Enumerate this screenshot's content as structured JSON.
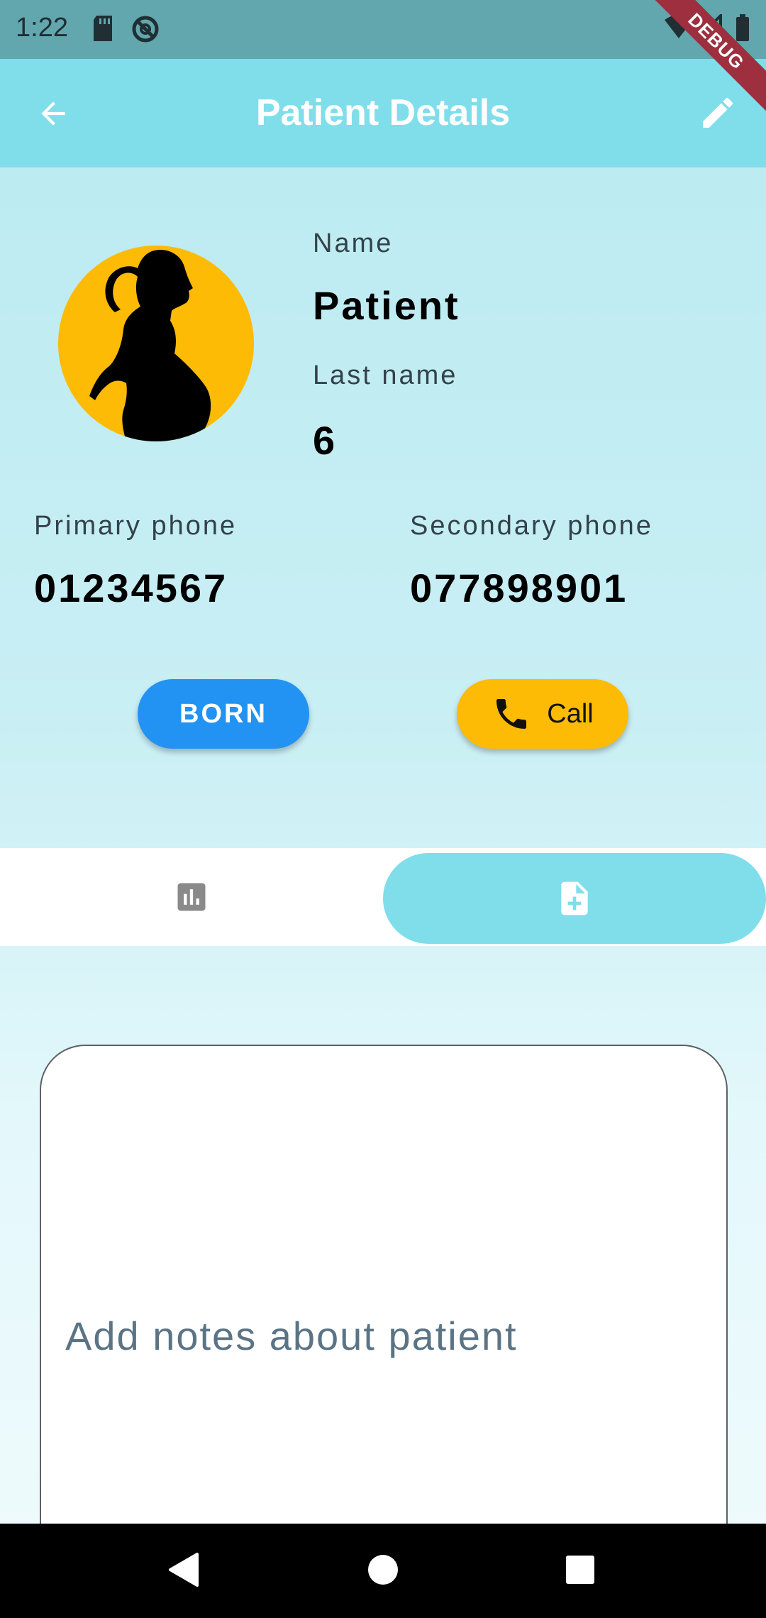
{
  "status_bar": {
    "time": "1:22",
    "debug_label": "DEBUG"
  },
  "app_bar": {
    "title": "Patient Details"
  },
  "patient": {
    "name_label": "Name",
    "name_value": "Patient",
    "last_name_label": "Last name",
    "last_name_value": "6",
    "primary_phone_label": "Primary phone",
    "primary_phone_value": "01234567",
    "secondary_phone_label": "Secondary phone",
    "secondary_phone_value": "077898901"
  },
  "actions": {
    "born_label": "BORN",
    "call_label": "Call"
  },
  "tabs": [
    {
      "icon": "bar-chart-icon",
      "selected": false
    },
    {
      "icon": "note-add-icon",
      "selected": true
    }
  ],
  "notes": {
    "placeholder": "Add notes about patient",
    "value": ""
  },
  "colors": {
    "app_bar": "#7fdeea",
    "status_bar": "#62a6ae",
    "avatar_bg": "#fdbb06",
    "born_button": "#2293f3",
    "call_button": "#fdbb06",
    "debug_banner": "#9d2f3f"
  }
}
